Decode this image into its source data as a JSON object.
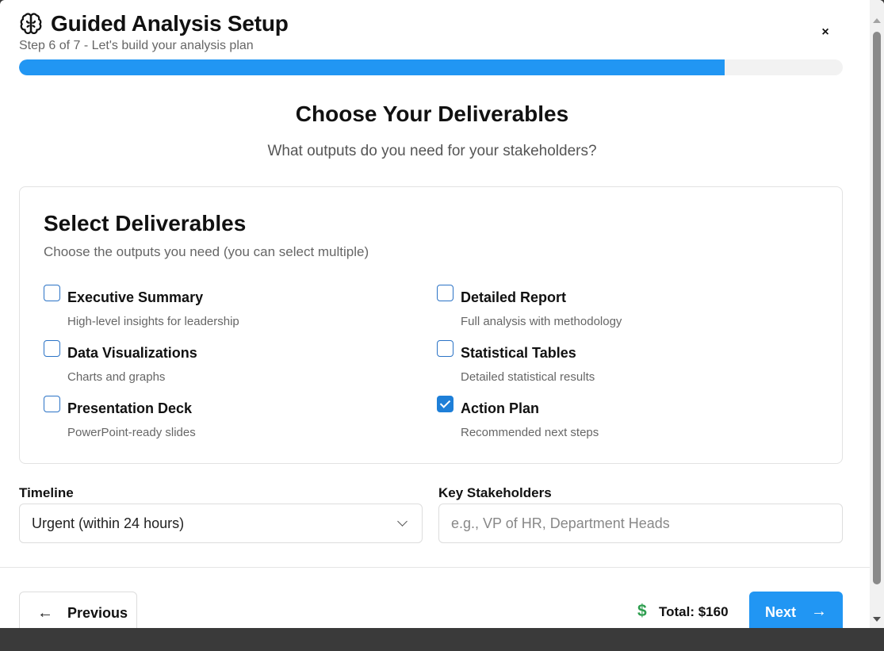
{
  "header": {
    "title": "Guided Analysis Setup",
    "subtitle": "Step 6 of 7 - Let's build your analysis plan",
    "close_label": "×",
    "progress_fraction": 0.857,
    "brain_icon": "brain-icon"
  },
  "step": {
    "title": "Choose Your Deliverables",
    "description": "What outputs do you need for your stakeholders?"
  },
  "deliverables": {
    "title": "Select Deliverables",
    "subtitle": "Choose the outputs you need (you can select multiple)",
    "options": [
      {
        "label": "Executive Summary",
        "desc": "High-level insights for leadership",
        "checked": false
      },
      {
        "label": "Detailed Report",
        "desc": "Full analysis with methodology",
        "checked": false
      },
      {
        "label": "Data Visualizations",
        "desc": "Charts and graphs",
        "checked": false
      },
      {
        "label": "Statistical Tables",
        "desc": "Detailed statistical results",
        "checked": false
      },
      {
        "label": "Presentation Deck",
        "desc": "PowerPoint-ready slides",
        "checked": false
      },
      {
        "label": "Action Plan",
        "desc": "Recommended next steps",
        "checked": true
      }
    ]
  },
  "form": {
    "timeline_label": "Timeline",
    "timeline_value": "Urgent (within 24 hours)",
    "stakeholders_label": "Key Stakeholders",
    "stakeholders_placeholder": "e.g., VP of HR, Department Heads",
    "stakeholders_value": ""
  },
  "footer": {
    "previous_label": "Previous",
    "total_label": "Total: $160",
    "dollar_icon": "$",
    "next_label": "Next"
  },
  "colors": {
    "accent": "#2196f3",
    "checkbox_checked": "#1e7fd8",
    "dollar": "#2e9e4f"
  }
}
